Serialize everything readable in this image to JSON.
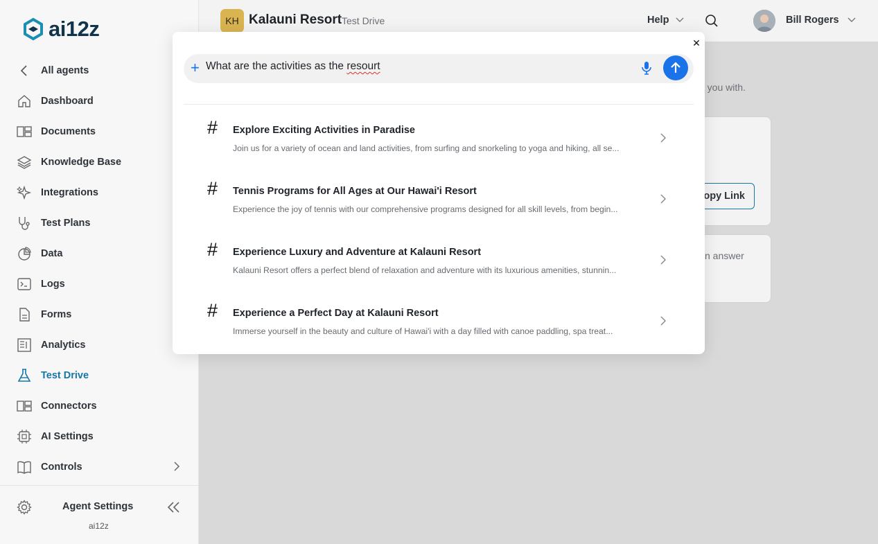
{
  "logo": {
    "text": "ai12z"
  },
  "sidebar": {
    "back_label": "All agents",
    "items": [
      {
        "label": "Dashboard",
        "icon": "home-icon"
      },
      {
        "label": "Documents",
        "icon": "documents-icon"
      },
      {
        "label": "Knowledge Base",
        "icon": "layers-icon"
      },
      {
        "label": "Integrations",
        "icon": "sparkle-icon"
      },
      {
        "label": "Test Plans",
        "icon": "stethoscope-icon"
      },
      {
        "label": "Data",
        "icon": "pie-chart-icon"
      },
      {
        "label": "Logs",
        "icon": "terminal-icon"
      },
      {
        "label": "Forms",
        "icon": "file-icon"
      },
      {
        "label": "Analytics",
        "icon": "report-icon"
      },
      {
        "label": "Test Drive",
        "icon": "flask-icon",
        "active": true
      },
      {
        "label": "Connectors",
        "icon": "connectors-icon"
      },
      {
        "label": "AI Settings",
        "icon": "chip-icon"
      },
      {
        "label": "Controls",
        "icon": "book-icon"
      }
    ],
    "footer": {
      "title": "Agent Settings",
      "subtitle": "ai12z"
    }
  },
  "header": {
    "badge": "KH",
    "title": "Kalauni Resort",
    "subtitle": "Test Drive",
    "help_label": "Help",
    "user_name": "Bill Rogers"
  },
  "background": {
    "partial_text_1": "es you with.",
    "copy_link_label": "opy Link",
    "partial_text_2": "n answer"
  },
  "search": {
    "query_prefix": "What are the activities as the ",
    "query_typo": "resourt"
  },
  "results": [
    {
      "title": "Explore Exciting Activities in Paradise",
      "description": "Join us for a variety of ocean and land activities, from surfing and snorkeling to yoga and hiking, all se..."
    },
    {
      "title": "Tennis Programs for All Ages at Our Hawai'i Resort",
      "description": "Experience the joy of tennis with our comprehensive programs designed for all skill levels, from begin..."
    },
    {
      "title": "Experience Luxury and Adventure at Kalauni Resort",
      "description": "Kalauni Resort offers a perfect blend of relaxation and adventure with its luxurious amenities, stunnin..."
    },
    {
      "title": "Experience a Perfect Day at Kalauni Resort",
      "description": "Immerse yourself in the beauty and culture of Hawai'i with a day filled with canoe paddling, spa treat..."
    }
  ],
  "colors": {
    "accent": "#1676a8",
    "send": "#1a73e8",
    "badge": "#d9b451"
  }
}
